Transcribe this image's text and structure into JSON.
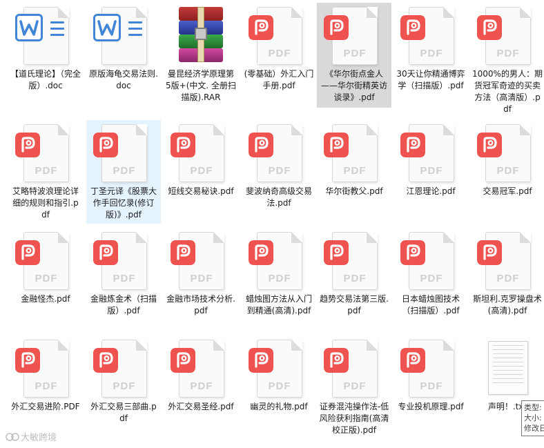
{
  "colors": {
    "pdf_badge": "#ef5350",
    "doc_accent": "#3f86d8",
    "hover_bg": "#e5f3ff",
    "selected_bg": "#d9d9d9"
  },
  "files": [
    {
      "name": "【道氏理论】（完全版）.doc",
      "type": "doc",
      "icon": "word-doc-icon"
    },
    {
      "name": "原版海龟交易法则.doc",
      "type": "doc",
      "icon": "word-doc-icon"
    },
    {
      "name": "曼昆经济学原理第5版+(中文. 全册扫描版).RAR",
      "type": "rar",
      "icon": "winrar-archive-icon"
    },
    {
      "name": "(零基础）外汇入门手册.pdf",
      "type": "pdf",
      "icon": "pdf-file-icon"
    },
    {
      "name": "《华尔街点金人——华尔街精英访谈录》.pdf",
      "type": "pdf",
      "icon": "pdf-file-icon",
      "state": "selected"
    },
    {
      "name": "30天让你精通博弈学（扫描版）.pdf",
      "type": "pdf",
      "icon": "pdf-file-icon"
    },
    {
      "name": "1000%的男人：期货冠军奇迹的买卖方法（高清版）.pdf",
      "type": "pdf",
      "icon": "pdf-file-icon"
    },
    {
      "name": "艾略特波浪理论详细的规则和指引.pdf",
      "type": "pdf",
      "icon": "pdf-file-icon"
    },
    {
      "name": "丁圣元译《股票大作手回忆录(修订版)》.pdf",
      "type": "pdf",
      "icon": "pdf-file-icon",
      "state": "hover"
    },
    {
      "name": "短线交易秘诀.pdf",
      "type": "pdf",
      "icon": "pdf-file-icon"
    },
    {
      "name": "斐波纳奇高级交易法.pdf",
      "type": "pdf",
      "icon": "pdf-file-icon"
    },
    {
      "name": "华尔街教父.pdf",
      "type": "pdf",
      "icon": "pdf-file-icon"
    },
    {
      "name": "江恩理论.pdf",
      "type": "pdf",
      "icon": "pdf-file-icon"
    },
    {
      "name": "交易冠军.pdf",
      "type": "pdf",
      "icon": "pdf-file-icon"
    },
    {
      "name": "金融怪杰.pdf",
      "type": "pdf",
      "icon": "pdf-file-icon"
    },
    {
      "name": "金融炼金术（扫描版）.pdf",
      "type": "pdf",
      "icon": "pdf-file-icon"
    },
    {
      "name": "金融市场技术分析.pdf",
      "type": "pdf",
      "icon": "pdf-file-icon"
    },
    {
      "name": "蜡烛图方法从入门到精通(高清).pdf",
      "type": "pdf",
      "icon": "pdf-file-icon"
    },
    {
      "name": "趋势交易法第三版.pdf",
      "type": "pdf",
      "icon": "pdf-file-icon"
    },
    {
      "name": "日本蜡烛图技术（扫描版）.pdf",
      "type": "pdf",
      "icon": "pdf-file-icon"
    },
    {
      "name": "斯坦利.克罗操盘术(高清).pdf",
      "type": "pdf",
      "icon": "pdf-file-icon"
    },
    {
      "name": "外汇交易进阶.PDF",
      "type": "pdf",
      "icon": "pdf-file-icon"
    },
    {
      "name": "外汇交易三部曲.pdf",
      "type": "pdf",
      "icon": "pdf-file-icon"
    },
    {
      "name": "外汇交易圣经.pdf",
      "type": "pdf",
      "icon": "pdf-file-icon"
    },
    {
      "name": "幽灵的礼物.pdf",
      "type": "pdf",
      "icon": "pdf-file-icon"
    },
    {
      "name": "证券混沌操作法-低风险获利指南(高清校正版).pdf",
      "type": "pdf",
      "icon": "pdf-file-icon"
    },
    {
      "name": "专业投机原理.pdf",
      "type": "pdf",
      "icon": "pdf-file-icon"
    },
    {
      "name": "声明！.txt",
      "type": "txt",
      "icon": "text-file-icon"
    }
  ],
  "pdf_label": "PDF",
  "tooltip": {
    "type": "类型:",
    "size": "大小:",
    "modified": "修改日"
  },
  "watermark": "大敏跨境"
}
